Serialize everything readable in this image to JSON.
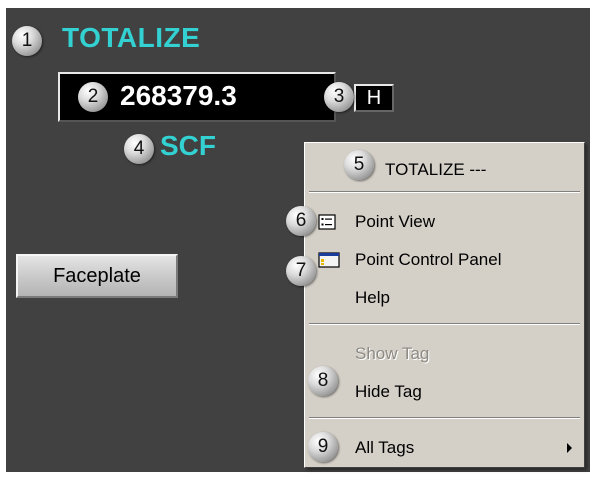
{
  "point": {
    "tag_name": "TOTALIZE",
    "value": "268379.3",
    "mode": "H",
    "units": "SCF"
  },
  "faceplate_button": {
    "label": "Faceplate"
  },
  "context_menu": {
    "header": "TOTALIZE ---",
    "items": [
      {
        "label": "Point View",
        "icon": "point-view-icon",
        "enabled": true
      },
      {
        "label": "Point Control Panel",
        "icon": "control-panel-icon",
        "enabled": true
      },
      {
        "label": "Help",
        "enabled": true
      },
      {
        "label": "Show Tag",
        "enabled": false
      },
      {
        "label": "Hide Tag",
        "enabled": true
      },
      {
        "label": "All Tags",
        "has_submenu": true,
        "enabled": true
      }
    ]
  },
  "callouts": [
    "1",
    "2",
    "3",
    "4",
    "5",
    "6",
    "7",
    "8",
    "9"
  ],
  "colors": {
    "panel_background": "#414141",
    "accent_cyan": "#33d1d1",
    "menu_background": "#d4d0c8"
  }
}
